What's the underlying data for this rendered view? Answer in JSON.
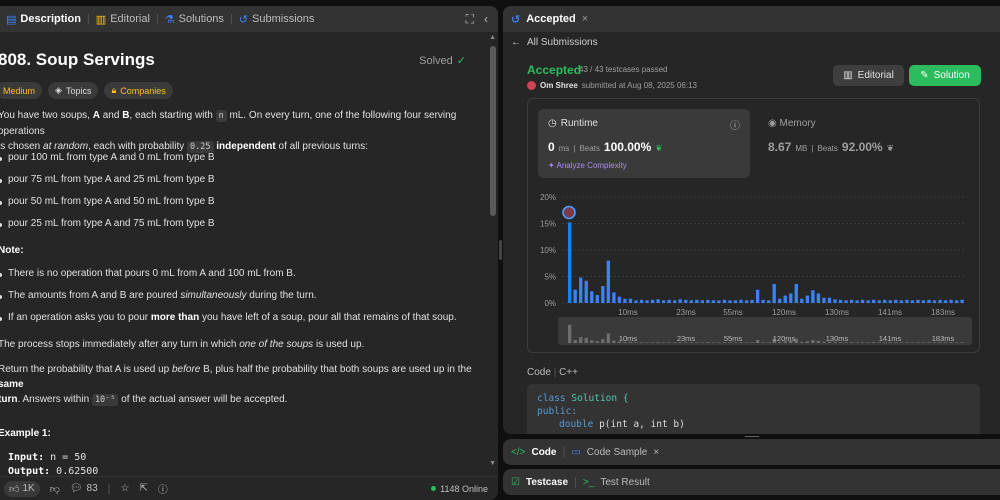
{
  "left_tabs": {
    "description": "Description",
    "editorial": "Editorial",
    "solutions": "Solutions",
    "submissions": "Submissions"
  },
  "problem": {
    "title": "808. Soup Servings",
    "status": "Solved",
    "tags": {
      "difficulty": "Medium",
      "topics": "Topics",
      "companies": "Companies"
    },
    "p1_a": "You have two soups, ",
    "p1_A": "A",
    "p1_and": " and ",
    "p1_B": "B",
    "p1_b": ", each starting with ",
    "p1_n": "n",
    "p1_c": " mL. On every turn, one of the following four serving operations",
    "p1_d": "is chosen ",
    "p1_random": "at random",
    "p1_e": ", each with probability ",
    "p1_prob": "0.25",
    "p1_indep": " independent",
    "p1_f": " of all previous turns:",
    "ops": [
      "pour 100 mL from type A and 0 mL from type B",
      "pour 75 mL from type A and 25 mL from type B",
      "pour 50 mL from type A and 50 mL from type B",
      "pour 25 mL from type A and 75 mL from type B"
    ],
    "note_label": "Note:",
    "note1": "There is no operation that pours 0 mL from A and 100 mL from B.",
    "note2_a": "The amounts from A and B are poured ",
    "note2_em": "simultaneously",
    "note2_b": " during the turn.",
    "note3_a": "If an operation asks you to pour ",
    "note3_b": "more than",
    "note3_c": " you have left of a soup, pour all that remains of that soup.",
    "stop_a": "The process stops immediately after any turn in which ",
    "stop_em": "one of the soups",
    "stop_b": " is used up.",
    "ret_a": "Return the probability that A is used up ",
    "ret_em": "before",
    "ret_b": " B, plus half the probability that both soups are used up in the ",
    "ret_same": "same",
    "ret_turn": "turn",
    "ret_c": ". Answers within ",
    "ret_tol": "10⁻⁵",
    "ret_d": " of the actual answer will be accepted.",
    "example_label": "Example 1:",
    "input_label": "Input:",
    "input_value": " n = 50",
    "output_label": "Output:",
    "output_value": " 0.62500"
  },
  "bottombar": {
    "likes": "1K",
    "comments": "83",
    "online": "1148 Online"
  },
  "right": {
    "tab": "Accepted",
    "back": "All Submissions",
    "accepted": "Accepted",
    "testcases": "43 / 43 testcases passed",
    "user": "Om Shree",
    "submitted": "submitted at Aug 08, 2025 06:13",
    "editorial_btn": "Editorial",
    "solution_btn": "Solution",
    "runtime": {
      "label": "Runtime",
      "value": "0",
      "unit": "ms",
      "beats_label": "Beats",
      "beats": "100.00%",
      "analyze": "Analyze Complexity"
    },
    "memory": {
      "label": "Memory",
      "value": "8.67",
      "unit": "MB",
      "beats_label": "Beats",
      "beats": "92.00%"
    },
    "code_label": "Code",
    "lang": "C++",
    "code": [
      "class Solution {",
      "public:",
      "double p(int a, int b)"
    ]
  },
  "bottom_tabs": {
    "code": "Code",
    "code_sample": "Code Sample",
    "testcase": "Testcase",
    "test_result": "Test Result"
  },
  "chart_data": {
    "type": "bar",
    "yticks": [
      "0%",
      "5%",
      "10%",
      "15%",
      "20%"
    ],
    "ylim": [
      0,
      20
    ],
    "xticks": [
      "10ms",
      "23ms",
      "55ms",
      "120ms",
      "130ms",
      "141ms",
      "183ms"
    ],
    "values": [
      15.2,
      2.5,
      4.8,
      4.2,
      2.2,
      1.5,
      3.2,
      8.0,
      2.0,
      1.2,
      0.8,
      0.8,
      0.5,
      0.6,
      0.5,
      0.6,
      0.7,
      0.5,
      0.6,
      0.5,
      0.7,
      0.6,
      0.5,
      0.6,
      0.5,
      0.6,
      0.5,
      0.5,
      0.6,
      0.5,
      0.5,
      0.6,
      0.5,
      0.6,
      2.5,
      0.6,
      0.5,
      3.6,
      0.8,
      1.4,
      1.8,
      3.6,
      0.8,
      1.4,
      2.4,
      1.8,
      1.0,
      1.0,
      0.7,
      0.6,
      0.5,
      0.6,
      0.5,
      0.6,
      0.5,
      0.6,
      0.5,
      0.6,
      0.5,
      0.6,
      0.5,
      0.6,
      0.5,
      0.6,
      0.5,
      0.6,
      0.5,
      0.6,
      0.5,
      0.6,
      0.5,
      0.6
    ],
    "highlight_index": 0,
    "colors": {
      "bar": "#3b82f6",
      "selected": "#0a84ff"
    }
  }
}
